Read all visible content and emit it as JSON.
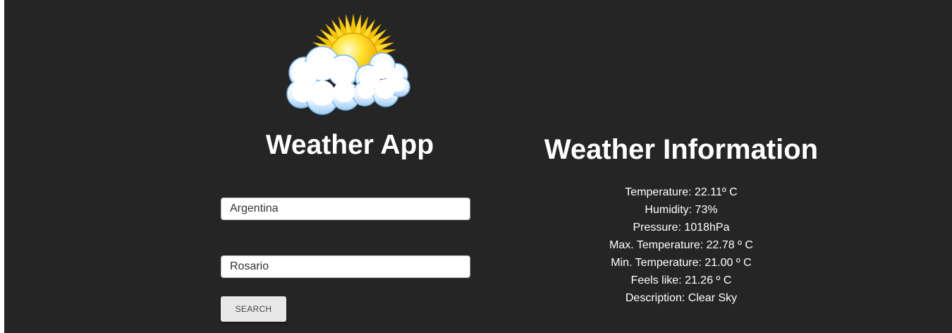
{
  "app": {
    "title": "Weather App",
    "logo_icon": "sun-behind-clouds-icon"
  },
  "form": {
    "country_value": "Argentina",
    "city_value": "Rosario",
    "search_label": "SEARCH"
  },
  "info": {
    "title": "Weather Information",
    "temperature": "Temperature: 22.11º C",
    "humidity": "Humidity: 73%",
    "pressure": "Pressure: 1018hPa",
    "max_temperature": "Max. Temperature: 22.78 º C",
    "min_temperature": "Min. Temperature: 21.00 º C",
    "feels_like": "Feels like: 21.26 º C",
    "description": "Description: Clear Sky"
  },
  "colors": {
    "background": "#252525",
    "text": "#ffffff",
    "button": "#e8e8e8"
  }
}
